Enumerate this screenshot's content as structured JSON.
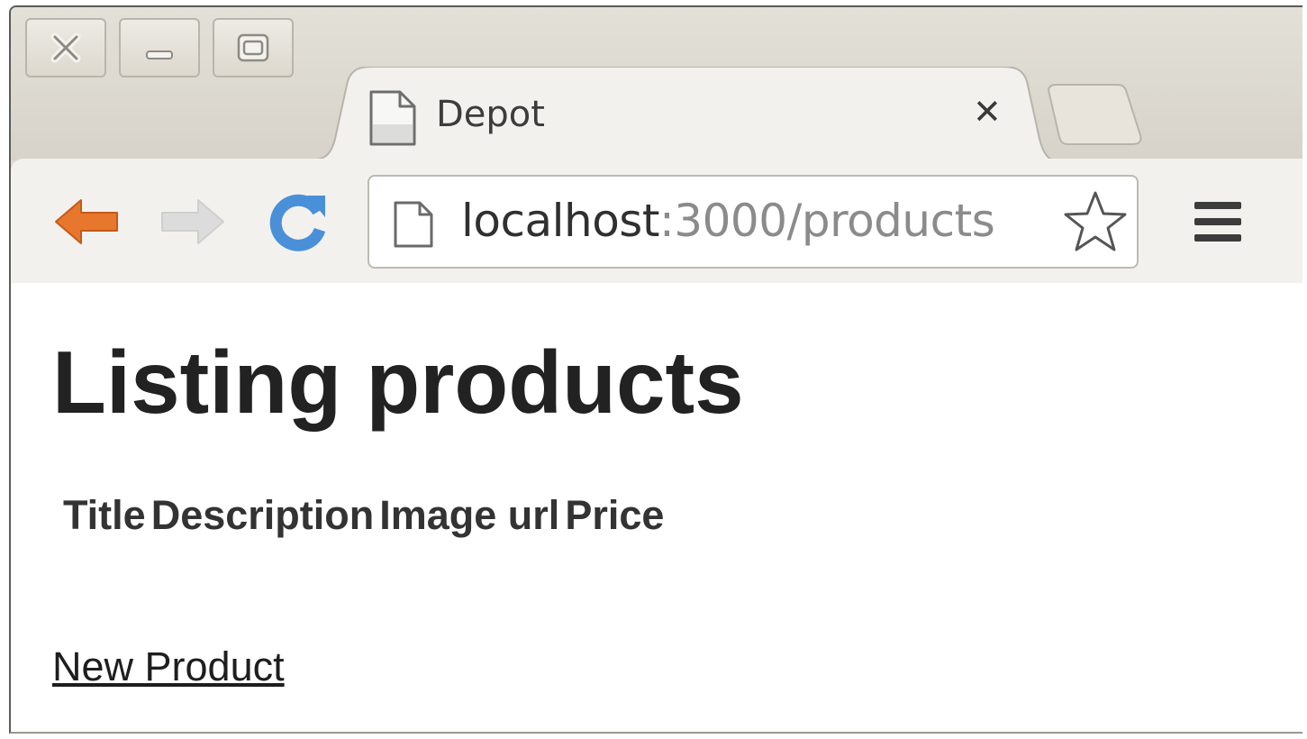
{
  "tab": {
    "title": "Depot"
  },
  "toolbar": {
    "url_host": "localhost",
    "url_rest": ":3000/products"
  },
  "page": {
    "heading": "Listing products",
    "table_headers": [
      "Title",
      "Description",
      "Image url",
      "Price"
    ],
    "new_link": "New Product"
  },
  "colors": {
    "back_arrow": "#e8772e",
    "reload": "#4a90d9",
    "forward_disabled": "#cfcfcf"
  }
}
